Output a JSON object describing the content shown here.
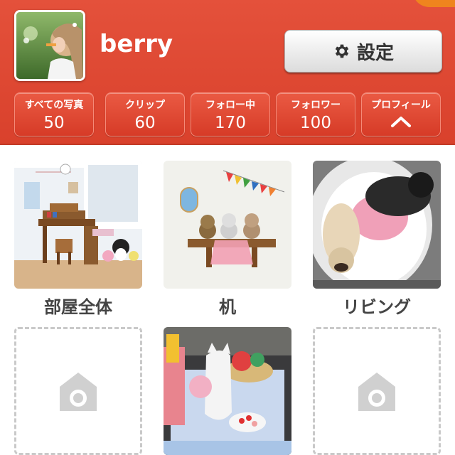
{
  "profile": {
    "username": "berry"
  },
  "settings": {
    "label": "設定"
  },
  "stats": [
    {
      "label": "すべての写真",
      "value": "50"
    },
    {
      "label": "クリップ",
      "value": "60"
    },
    {
      "label": "フォロー中",
      "value": "170"
    },
    {
      "label": "フォロワー",
      "value": "100"
    },
    {
      "label": "プロフィール"
    }
  ],
  "rooms": [
    {
      "caption": "部屋全体",
      "photo": "room-overview-photo"
    },
    {
      "caption": "机",
      "photo": "desk-shelf-photo"
    },
    {
      "caption": "リビング",
      "photo": "living-dogs-photo"
    },
    {
      "caption": "",
      "photo": "empty-camera-placeholder"
    },
    {
      "caption": "",
      "photo": "cat-figurine-photo"
    },
    {
      "caption": "",
      "photo": "empty-camera-placeholder"
    }
  ],
  "colors": {
    "header": "#d9412c",
    "stat_button": "#e04a35",
    "caption": "#444444"
  }
}
